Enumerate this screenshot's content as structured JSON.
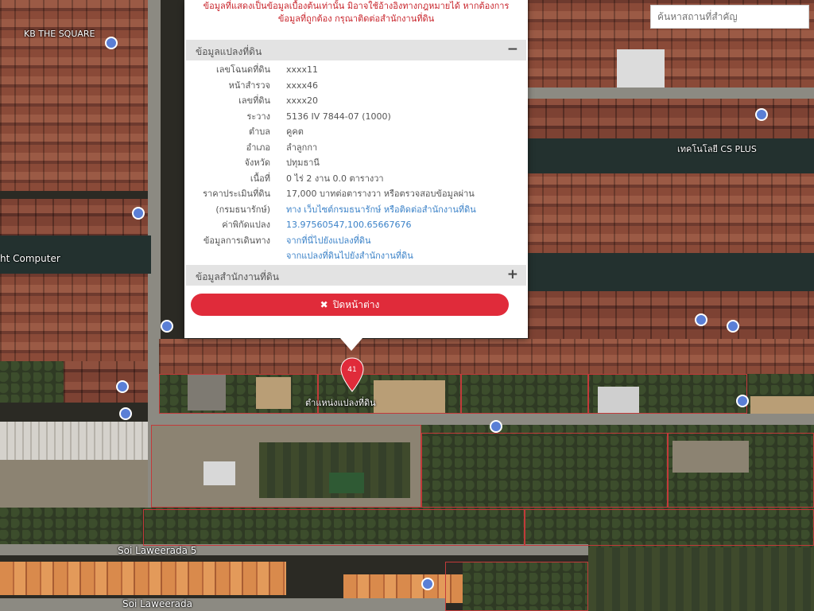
{
  "search": {
    "placeholder": "ค้นหาสถานที่สำคัญ"
  },
  "popup": {
    "notice": "ข้อมูลที่แสดงเป็นข้อมูลเบื้องต้นเท่านั้น มิอาจใช้อ้างอิงทางกฎหมายได้ หากต้องการข้อมูลที่ถูกต้อง กรุณาติดต่อสำนักงานที่ดิน",
    "section_parcel": {
      "title": "ข้อมูลแปลงที่ดิน",
      "toggle": "−"
    },
    "rows": [
      {
        "label": "เลขโฉนดที่ดิน",
        "value": "xxxx11"
      },
      {
        "label": "หน้าสำรวจ",
        "value": "xxxx46"
      },
      {
        "label": "เลขที่ดิน",
        "value": "xxxx20"
      },
      {
        "label": "ระวาง",
        "value": "5136 IV 7844-07 (1000)"
      },
      {
        "label": "ตำบล",
        "value": "คูคต"
      },
      {
        "label": "อำเภอ",
        "value": "ลำลูกกา"
      },
      {
        "label": "จังหวัด",
        "value": "ปทุมธานี"
      },
      {
        "label": "เนื้อที่",
        "value": "0 ไร่ 2 งาน 0.0 ตารางวา"
      }
    ],
    "appraisal": {
      "label_1": "ราคาประเมินที่ดิน",
      "label_2": "(กรมธนารักษ์)",
      "value_1": "17,000 บาทต่อตารางวา หรือตรวจสอบข้อมูลผ่าน",
      "value_2_prefix": "ทาง ",
      "value_2_link": "เว็บไซต์กรมธนารักษ์",
      "value_2_suffix": " หรือติดต่อสำนักงานที่ดิน"
    },
    "coords": {
      "label": "ค่าพิกัดแปลง",
      "value": "13.97560547,100.65667676"
    },
    "travel": {
      "label": "ข้อมูลการเดินทาง",
      "link_1": "จากที่นี่ไปยังแปลงที่ดิน",
      "link_2": "จากแปลงที่ดินไปยังสำนักงานที่ดิน"
    },
    "section_office": {
      "title": "ข้อมูลสำนักงานที่ดิน",
      "toggle": "+"
    },
    "close_label": "ปิดหน้าต่าง",
    "close_icon": "✖"
  },
  "marker": {
    "number": "41",
    "label": "ตำแหน่งแปลงที่ดิน",
    "color": "#e02b3a"
  },
  "map_labels": {
    "kb_square": "KB THE SQUARE",
    "computer": "ht Computer",
    "soi_laweerada_5": "Soi Laweerada 5",
    "soi_laweerada": "Soi Laweerada",
    "cs_plus": "เทคโนโลยี CS PLUS"
  },
  "colors": {
    "accent": "#e02b3a",
    "link": "#3b82c8",
    "notice": "#c8242b"
  }
}
